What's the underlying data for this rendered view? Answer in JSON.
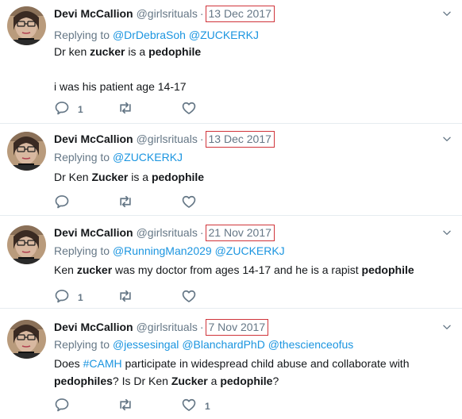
{
  "tweets": [
    {
      "name": "Devi McCallion",
      "handle": "@girlsrituals",
      "date": "13 Dec 2017",
      "replying_prefix": "Replying to ",
      "replying_to": [
        "@DrDebraSoh",
        "@ZUCKERKJ"
      ],
      "lines": [
        [
          {
            "t": "Dr ken ",
            "b": false
          },
          {
            "t": "zucker",
            "b": true
          },
          {
            "t": " is a ",
            "b": false
          },
          {
            "t": "pedophile",
            "b": true
          }
        ],
        [],
        [
          {
            "t": "i was  his patient age 14-17",
            "b": false
          }
        ]
      ],
      "reply_count": "1",
      "retweet_count": "",
      "like_count": ""
    },
    {
      "name": "Devi McCallion",
      "handle": "@girlsrituals",
      "date": "13 Dec 2017",
      "replying_prefix": "Replying to ",
      "replying_to": [
        "@ZUCKERKJ"
      ],
      "lines": [
        [
          {
            "t": "Dr Ken ",
            "b": false
          },
          {
            "t": "Zucker",
            "b": true
          },
          {
            "t": " is a ",
            "b": false
          },
          {
            "t": "pedophile",
            "b": true
          }
        ]
      ],
      "reply_count": "",
      "retweet_count": "",
      "like_count": ""
    },
    {
      "name": "Devi McCallion",
      "handle": "@girlsrituals",
      "date": "21 Nov 2017",
      "replying_prefix": "Replying to ",
      "replying_to": [
        "@RunningMan2029",
        "@ZUCKERKJ"
      ],
      "lines": [
        [
          {
            "t": "Ken ",
            "b": false
          },
          {
            "t": "zucker",
            "b": true
          },
          {
            "t": " was my doctor from ages 14-17 and he is a rapist ",
            "b": false
          },
          {
            "t": "pedophile",
            "b": true
          }
        ]
      ],
      "reply_count": "1",
      "retweet_count": "",
      "like_count": ""
    },
    {
      "name": "Devi McCallion",
      "handle": "@girlsrituals",
      "date": "7 Nov 2017",
      "replying_prefix": "Replying to ",
      "replying_to": [
        "@jessesingal",
        "@BlanchardPhD",
        "@thescienceofus"
      ],
      "lines": [
        [
          {
            "t": "Does ",
            "b": false
          },
          {
            "t": "#CAMH",
            "b": false,
            "h": true
          },
          {
            "t": " participate in widespread child abuse and collaborate with",
            "b": false
          }
        ],
        [
          {
            "t": "pedophiles",
            "b": true
          },
          {
            "t": "? Is Dr Ken ",
            "b": false
          },
          {
            "t": "Zucker",
            "b": true
          },
          {
            "t": " a ",
            "b": false
          },
          {
            "t": "pedophile",
            "b": true
          },
          {
            "t": "?",
            "b": false
          }
        ]
      ],
      "reply_count": "",
      "retweet_count": "",
      "like_count": "1"
    }
  ],
  "separator": "·",
  "colors": {
    "text": "#14171a",
    "muted": "#657786",
    "link": "#1b95e0",
    "highlight_box": "#d0343a",
    "divider": "#e6ecf0"
  },
  "icons": {
    "reply": "reply-icon",
    "retweet": "retweet-icon",
    "like": "heart-icon",
    "more": "chevron-down-icon"
  }
}
